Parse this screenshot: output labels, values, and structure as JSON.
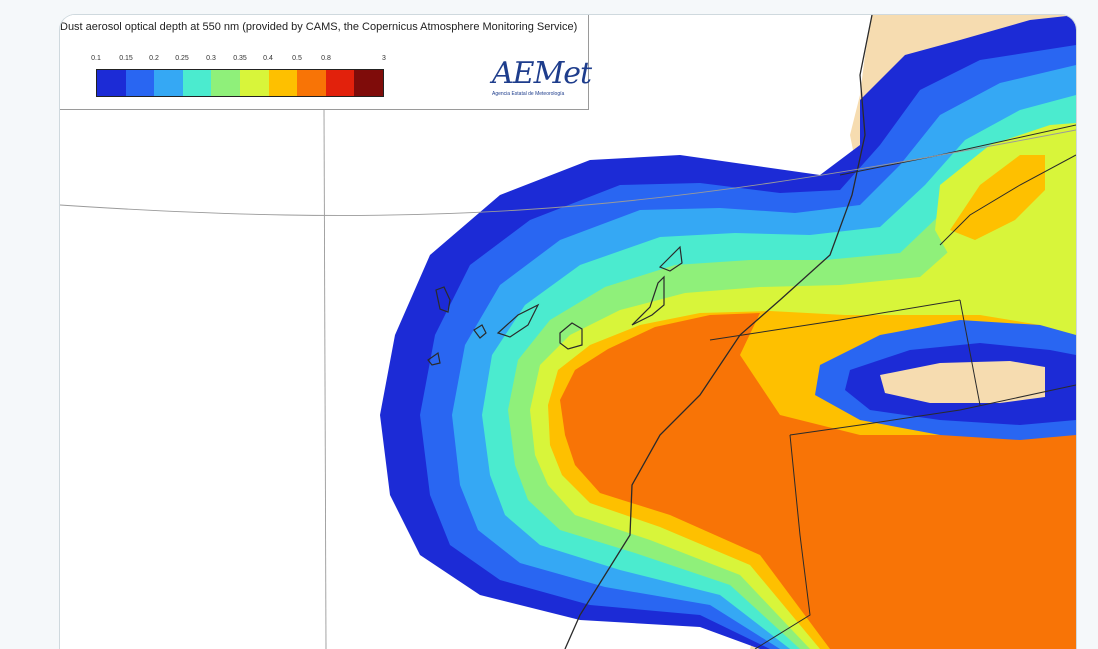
{
  "map": {
    "title": "Dust aerosol optical depth at 550 nm (provided by CAMS, the Copernicus Atmosphere Monitoring Service)",
    "legend": {
      "ticks": [
        "0.1",
        "0.15",
        "0.2",
        "0.25",
        "0.3",
        "0.35",
        "0.4",
        "0.5",
        "0.8",
        "3"
      ],
      "colors": [
        "#1c2bd6",
        "#2966f2",
        "#35a8f4",
        "#4bebcf",
        "#8ff07a",
        "#d8f53a",
        "#fec000",
        "#f87406",
        "#e2210c",
        "#7f0c0a"
      ]
    },
    "logo": {
      "text": "AEMet",
      "subtitle": "Agencia Estatal de Meteorología"
    },
    "colors": {
      "land": "#f6dcb0",
      "sea": "#ffffff",
      "border": "#2a2a2a",
      "grid": "#9a9a9a"
    }
  }
}
